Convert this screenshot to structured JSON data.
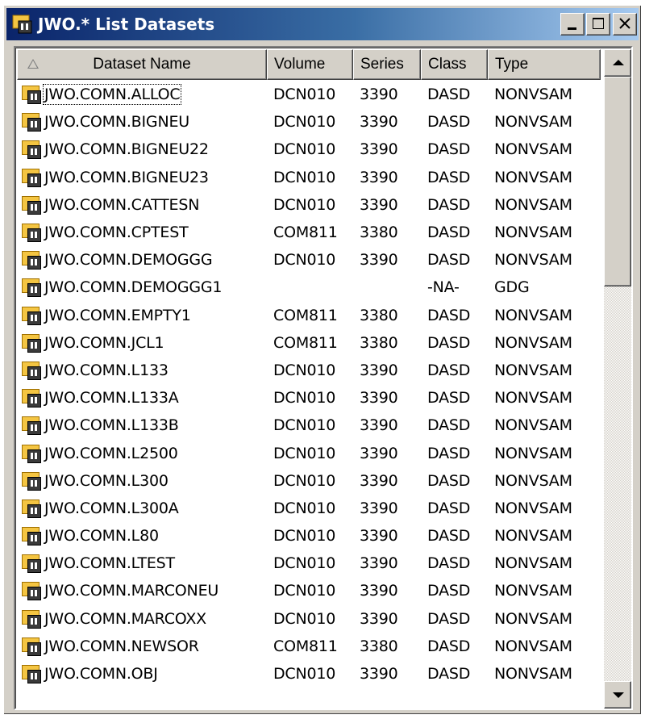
{
  "window": {
    "title": "JWO.* List Datasets",
    "controls": {
      "minimize_icon": "minimize-icon",
      "maximize_icon": "maximize-icon",
      "close_icon": "close-icon"
    }
  },
  "table": {
    "columns": [
      "Dataset Name",
      "Volume",
      "Series",
      "Class",
      "Type"
    ],
    "sorted_column": "Dataset Name",
    "rows": [
      {
        "name": "JWO.COMN.ALLOC",
        "volume": "DCN010",
        "series": "3390",
        "class": "DASD",
        "type": "NONVSAM"
      },
      {
        "name": "JWO.COMN.BIGNEU",
        "volume": "DCN010",
        "series": "3390",
        "class": "DASD",
        "type": "NONVSAM"
      },
      {
        "name": "JWO.COMN.BIGNEU22",
        "volume": "DCN010",
        "series": "3390",
        "class": "DASD",
        "type": "NONVSAM"
      },
      {
        "name": "JWO.COMN.BIGNEU23",
        "volume": "DCN010",
        "series": "3390",
        "class": "DASD",
        "type": "NONVSAM"
      },
      {
        "name": "JWO.COMN.CATTESN",
        "volume": "DCN010",
        "series": "3390",
        "class": "DASD",
        "type": "NONVSAM"
      },
      {
        "name": "JWO.COMN.CPTEST",
        "volume": "COM811",
        "series": "3380",
        "class": "DASD",
        "type": "NONVSAM"
      },
      {
        "name": "JWO.COMN.DEMOGGG",
        "volume": "DCN010",
        "series": "3390",
        "class": "DASD",
        "type": "NONVSAM"
      },
      {
        "name": "JWO.COMN.DEMOGGG1",
        "volume": "",
        "series": "",
        "class": "-NA-",
        "type": "GDG"
      },
      {
        "name": "JWO.COMN.EMPTY1",
        "volume": "COM811",
        "series": "3380",
        "class": "DASD",
        "type": "NONVSAM"
      },
      {
        "name": "JWO.COMN.JCL1",
        "volume": "COM811",
        "series": "3380",
        "class": "DASD",
        "type": "NONVSAM"
      },
      {
        "name": "JWO.COMN.L133",
        "volume": "DCN010",
        "series": "3390",
        "class": "DASD",
        "type": "NONVSAM"
      },
      {
        "name": "JWO.COMN.L133A",
        "volume": "DCN010",
        "series": "3390",
        "class": "DASD",
        "type": "NONVSAM"
      },
      {
        "name": "JWO.COMN.L133B",
        "volume": "DCN010",
        "series": "3390",
        "class": "DASD",
        "type": "NONVSAM"
      },
      {
        "name": "JWO.COMN.L2500",
        "volume": "DCN010",
        "series": "3390",
        "class": "DASD",
        "type": "NONVSAM"
      },
      {
        "name": "JWO.COMN.L300",
        "volume": "DCN010",
        "series": "3390",
        "class": "DASD",
        "type": "NONVSAM"
      },
      {
        "name": "JWO.COMN.L300A",
        "volume": "DCN010",
        "series": "3390",
        "class": "DASD",
        "type": "NONVSAM"
      },
      {
        "name": "JWO.COMN.L80",
        "volume": "DCN010",
        "series": "3390",
        "class": "DASD",
        "type": "NONVSAM"
      },
      {
        "name": "JWO.COMN.LTEST",
        "volume": "DCN010",
        "series": "3390",
        "class": "DASD",
        "type": "NONVSAM"
      },
      {
        "name": "JWO.COMN.MARCONEU",
        "volume": "DCN010",
        "series": "3390",
        "class": "DASD",
        "type": "NONVSAM"
      },
      {
        "name": "JWO.COMN.MARCOXX",
        "volume": "DCN010",
        "series": "3390",
        "class": "DASD",
        "type": "NONVSAM"
      },
      {
        "name": "JWO.COMN.NEWSOR",
        "volume": "COM811",
        "series": "3380",
        "class": "DASD",
        "type": "NONVSAM"
      },
      {
        "name": "JWO.COMN.OBJ",
        "volume": "DCN010",
        "series": "3390",
        "class": "DASD",
        "type": "NONVSAM"
      }
    ],
    "row_icon": "dataset-icon",
    "focused_row": 0
  },
  "colors": {
    "titlebar_start": "#0a246a",
    "titlebar_end": "#a6caf0",
    "face": "#d4d0c8"
  }
}
